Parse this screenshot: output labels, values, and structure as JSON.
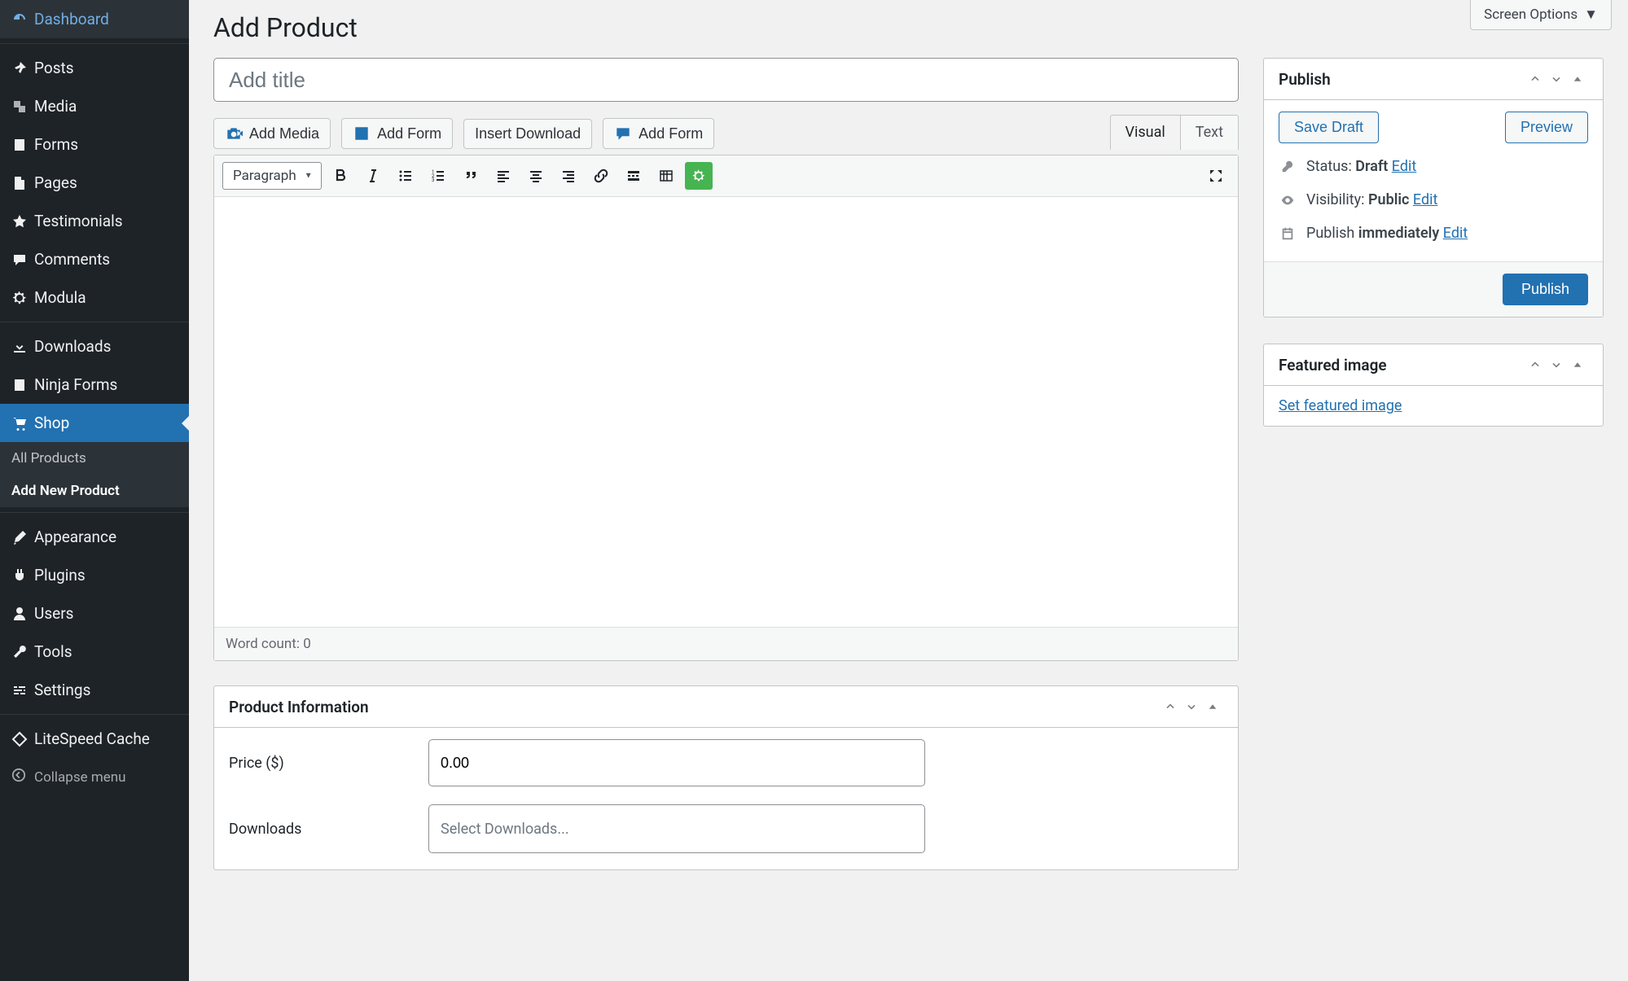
{
  "header": {
    "title": "Add Product",
    "screen_options": "Screen Options"
  },
  "sidebar": {
    "collapse": "Collapse menu",
    "items": [
      {
        "label": "Dashboard",
        "icon": "dashboard"
      },
      {
        "label": "Posts",
        "icon": "pin"
      },
      {
        "label": "Media",
        "icon": "media"
      },
      {
        "label": "Forms",
        "icon": "forms"
      },
      {
        "label": "Pages",
        "icon": "pages"
      },
      {
        "label": "Testimonials",
        "icon": "star"
      },
      {
        "label": "Comments",
        "icon": "comment"
      },
      {
        "label": "Modula",
        "icon": "modula"
      },
      {
        "label": "Downloads",
        "icon": "download"
      },
      {
        "label": "Ninja Forms",
        "icon": "ninja"
      },
      {
        "label": "Shop",
        "icon": "cart",
        "active": true
      },
      {
        "label": "Appearance",
        "icon": "brush"
      },
      {
        "label": "Plugins",
        "icon": "plug"
      },
      {
        "label": "Users",
        "icon": "user"
      },
      {
        "label": "Tools",
        "icon": "wrench"
      },
      {
        "label": "Settings",
        "icon": "settings"
      },
      {
        "label": "LiteSpeed Cache",
        "icon": "litespeed"
      }
    ],
    "sub": {
      "items": [
        {
          "label": "All Products"
        },
        {
          "label": "Add New Product",
          "current": true
        }
      ]
    }
  },
  "title_input": {
    "placeholder": "Add title",
    "value": ""
  },
  "editor_buttons": [
    {
      "label": "Add Media",
      "icon": "media"
    },
    {
      "label": "Add Form",
      "icon": "form"
    },
    {
      "label": "Insert Download"
    },
    {
      "label": "Add Form",
      "icon": "chat"
    }
  ],
  "editor": {
    "tabs": {
      "visual": "Visual",
      "text": "Text"
    },
    "paragraph": "Paragraph",
    "word_count_label": "Word count: ",
    "word_count": "0"
  },
  "panels": {
    "publish": {
      "title": "Publish",
      "save_draft": "Save Draft",
      "preview": "Preview",
      "status_label": "Status: ",
      "status_value": "Draft",
      "visibility_label": "Visibility: ",
      "visibility_value": "Public",
      "schedule_label": "Publish ",
      "schedule_value": "immediately",
      "edit": "Edit",
      "publish_btn": "Publish"
    },
    "featured": {
      "title": "Featured image",
      "link": "Set featured image"
    },
    "product_info": {
      "title": "Product Information",
      "price_label": "Price ($)",
      "price_value": "0.00",
      "downloads_label": "Downloads",
      "downloads_placeholder": "Select Downloads..."
    }
  }
}
